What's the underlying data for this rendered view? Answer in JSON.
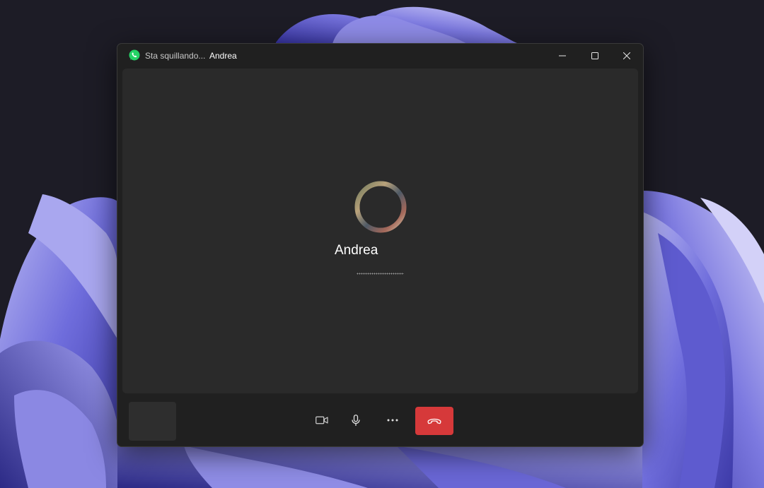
{
  "window": {
    "status": "Sta squillando...",
    "contact_name": "Andrea"
  },
  "call": {
    "contact_name": "Andrea",
    "state": "ringing"
  },
  "icons": {
    "app": "whatsapp-icon",
    "minimize": "minimize-icon",
    "maximize": "maximize-icon",
    "close": "close-icon",
    "camera": "video-camera-icon",
    "microphone": "microphone-icon",
    "more": "more-options-icon",
    "hangup": "hang-up-phone-icon"
  },
  "colors": {
    "window_bg": "#202020",
    "video_bg": "#2a2a2a",
    "hangup": "#d6393a",
    "whatsapp": "#25d366",
    "wallpaper_bloom": "#6a68d8"
  }
}
